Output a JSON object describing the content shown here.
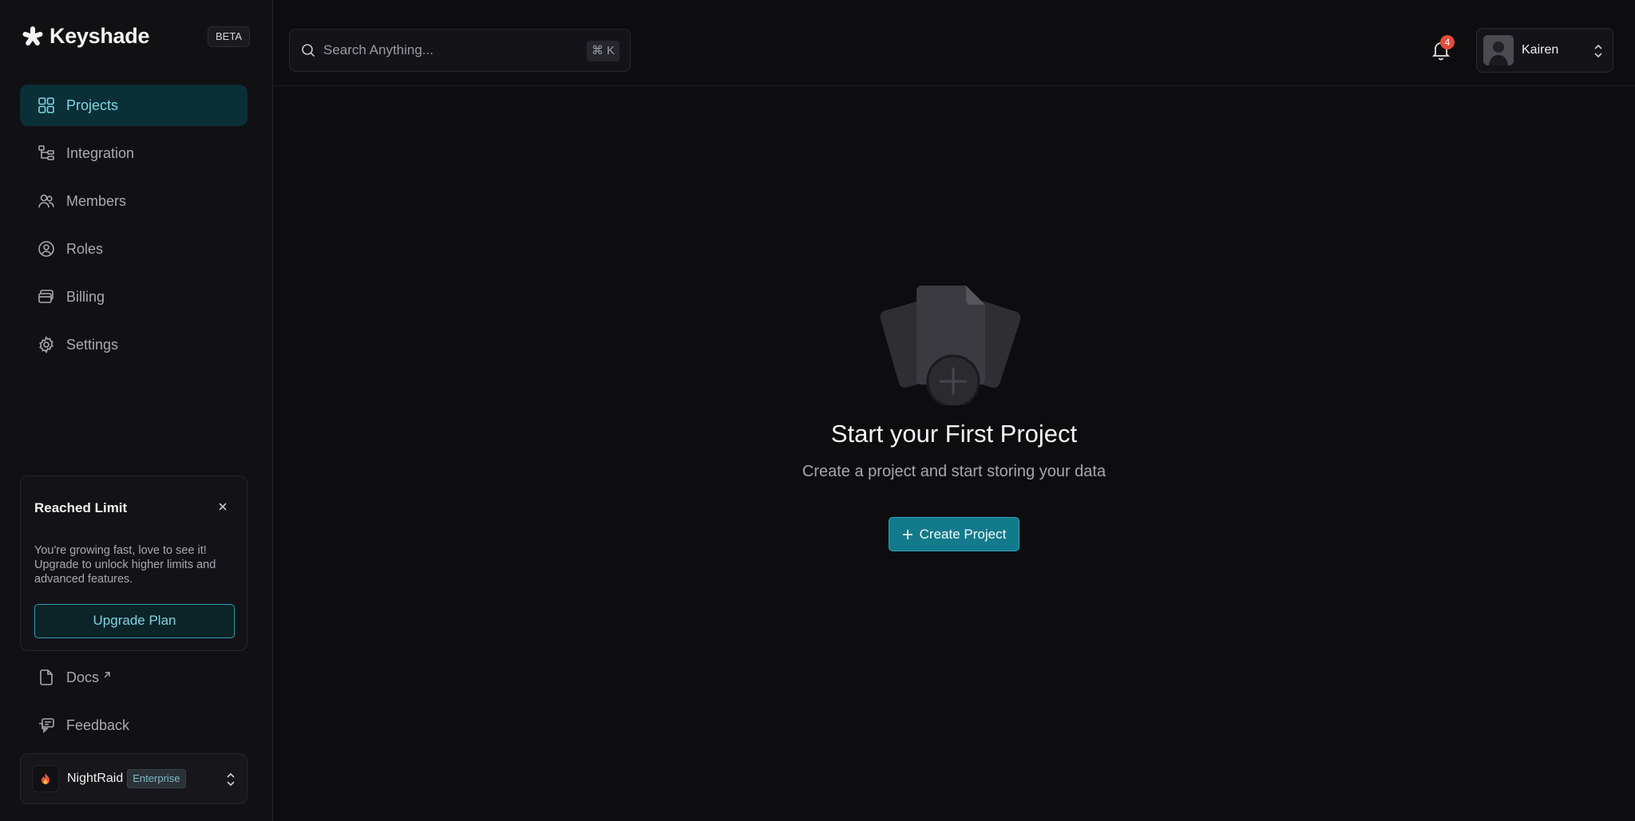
{
  "app": {
    "name": "Keyshade",
    "badge": "BETA"
  },
  "sidebar": {
    "items": [
      {
        "label": "Projects",
        "icon": "grid-icon",
        "active": true
      },
      {
        "label": "Integration",
        "icon": "integration-icon",
        "active": false
      },
      {
        "label": "Members",
        "icon": "members-icon",
        "active": false
      },
      {
        "label": "Roles",
        "icon": "roles-icon",
        "active": false
      },
      {
        "label": "Billing",
        "icon": "billing-icon",
        "active": false
      },
      {
        "label": "Settings",
        "icon": "gear-icon",
        "active": false
      }
    ],
    "limit_card": {
      "title": "Reached Limit",
      "text": "You're growing fast, love to see it! Upgrade to unlock higher limits and advanced features.",
      "button": "Upgrade Plan"
    },
    "docs": "Docs",
    "feedback": "Feedback",
    "workspace": {
      "name": "NightRaid",
      "plan": "Enterprise"
    }
  },
  "header": {
    "search_placeholder": "Search Anything...",
    "shortcut": "⌘ K",
    "notifications": "4",
    "user_name": "Kairen"
  },
  "empty_state": {
    "title": "Start your First Project",
    "subtitle": "Create a project and start storing your data",
    "button": "Create Project"
  },
  "colors": {
    "accent": "#137a8c",
    "active_bg": "#0a2f37",
    "active_text": "#7fd3e4",
    "badge": "#e24c3b"
  }
}
